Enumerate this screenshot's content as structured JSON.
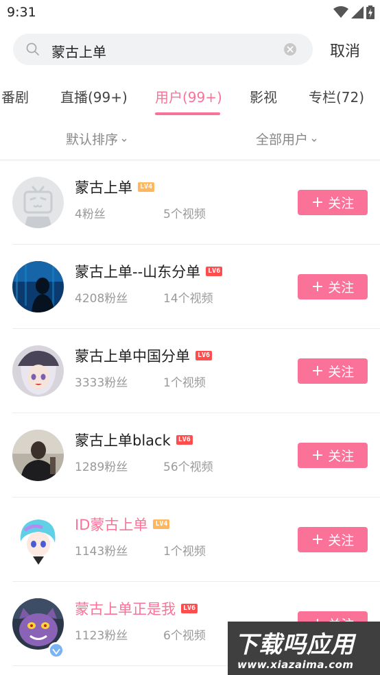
{
  "status_bar": {
    "time": "9:31"
  },
  "search": {
    "query": "蒙古上单",
    "cancel_label": "取消"
  },
  "tabs": [
    {
      "label": "番剧"
    },
    {
      "label": "直播(99+)"
    },
    {
      "label": "用户(99+)",
      "active": true
    },
    {
      "label": "影视"
    },
    {
      "label": "专栏(72)"
    }
  ],
  "filters": {
    "sort_label": "默认排序",
    "type_label": "全部用户"
  },
  "users": [
    {
      "name": "蒙古上单",
      "level": "LV4",
      "fans": "4粉丝",
      "videos": "5个视频",
      "follow_label": "关注",
      "avatar": "default-tv-avatar"
    },
    {
      "name": "蒙古上单--山东分单",
      "level": "LV6",
      "fans": "4208粉丝",
      "videos": "14个视频",
      "follow_label": "关注",
      "avatar": "aquarium-avatar"
    },
    {
      "name": "蒙古上单中国分单",
      "level": "LV6",
      "fans": "3333粉丝",
      "videos": "1个视频",
      "follow_label": "关注",
      "avatar": "anime-girl-avatar"
    },
    {
      "name": "蒙古上单black",
      "level": "LV6",
      "fans": "1289粉丝",
      "videos": "56个视频",
      "follow_label": "关注",
      "avatar": "man-photo-avatar"
    },
    {
      "name": "ID蒙古上单",
      "level": "LV4",
      "fans": "1143粉丝",
      "videos": "1个视频",
      "follow_label": "关注",
      "avatar": "anime-blue-hair-avatar"
    },
    {
      "name": "蒙古上单正是我",
      "level": "LV6",
      "fans": "1123粉丝",
      "videos": "6个视频",
      "follow_label": "关注",
      "avatar": "purple-cat-avatar"
    }
  ],
  "watermark": {
    "title": "下载吗应用",
    "url": "www.xiazaima.com"
  },
  "colors": {
    "accent": "#fb7299",
    "lv4": "#ffb65c",
    "lv6": "#ff4d4d"
  }
}
